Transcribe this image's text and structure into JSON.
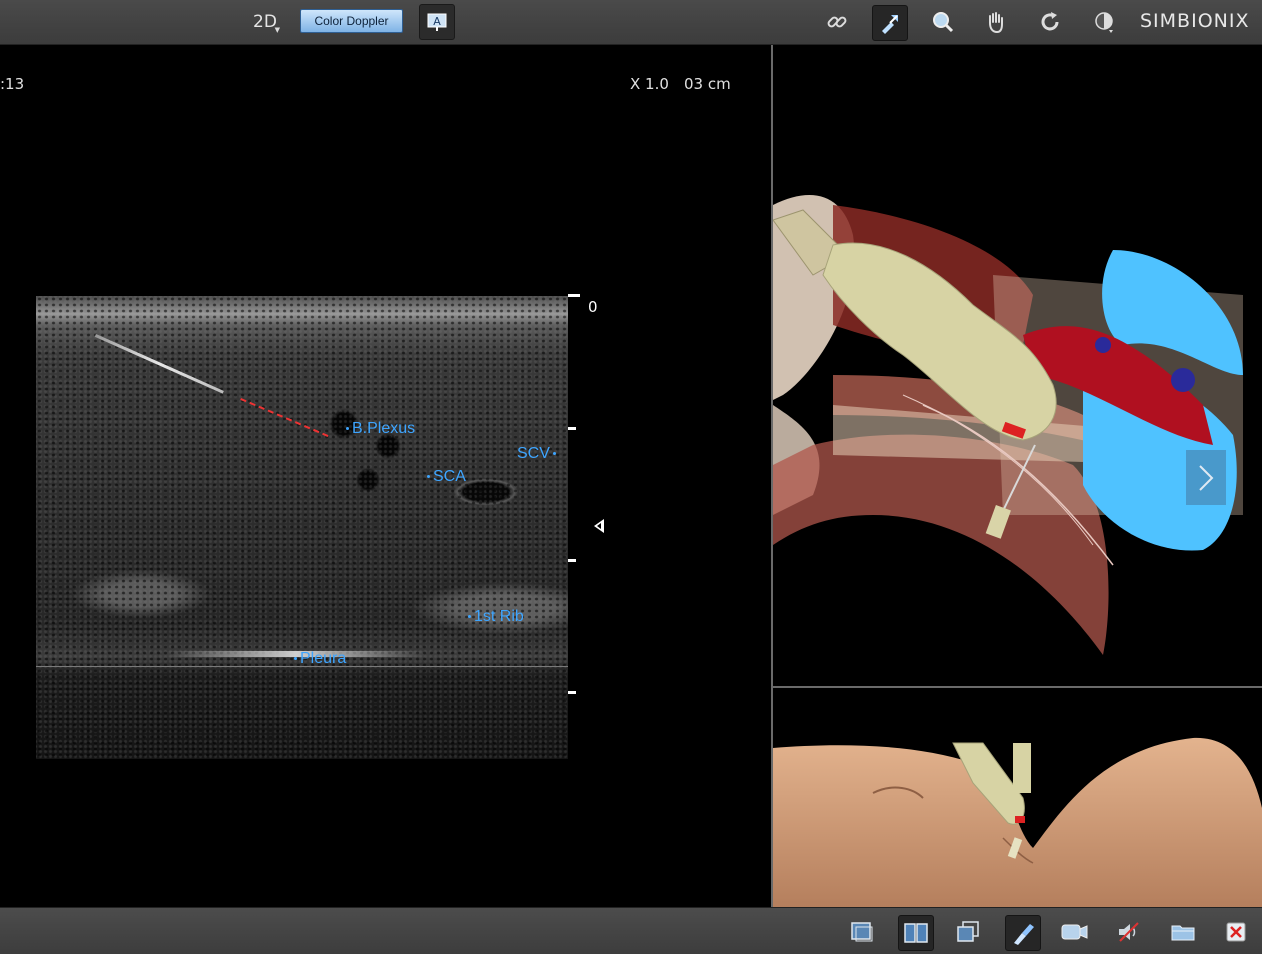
{
  "toolbar": {
    "mode_label": "2D",
    "color_doppler_label": "Color Doppler",
    "brand": "SIMBIONIX",
    "icons": [
      "link-icon",
      "probe-tool-icon",
      "zoom-icon",
      "pan-hand-icon",
      "rotate-icon",
      "contrast-icon"
    ]
  },
  "ultrasound": {
    "timer": ":13",
    "zoom": "X 1.0",
    "depth": "03 cm",
    "scale_zero": "0",
    "labels": {
      "b_plexus": "B.Plexus",
      "sca": "SCA",
      "scv": "SCV",
      "first_rib": "1st Rib",
      "pleura": "Pleura"
    }
  },
  "bottom_toolbar": {
    "icons": [
      "single-view-icon",
      "split-view-icon",
      "overlay-view-icon",
      "probe-view-icon",
      "camera-icon",
      "sound-icon",
      "folder-icon",
      "close-icon"
    ]
  },
  "colors": {
    "label_blue": "#3ea5ff",
    "needle_path_red": "#e33",
    "active_button": "#262626"
  }
}
